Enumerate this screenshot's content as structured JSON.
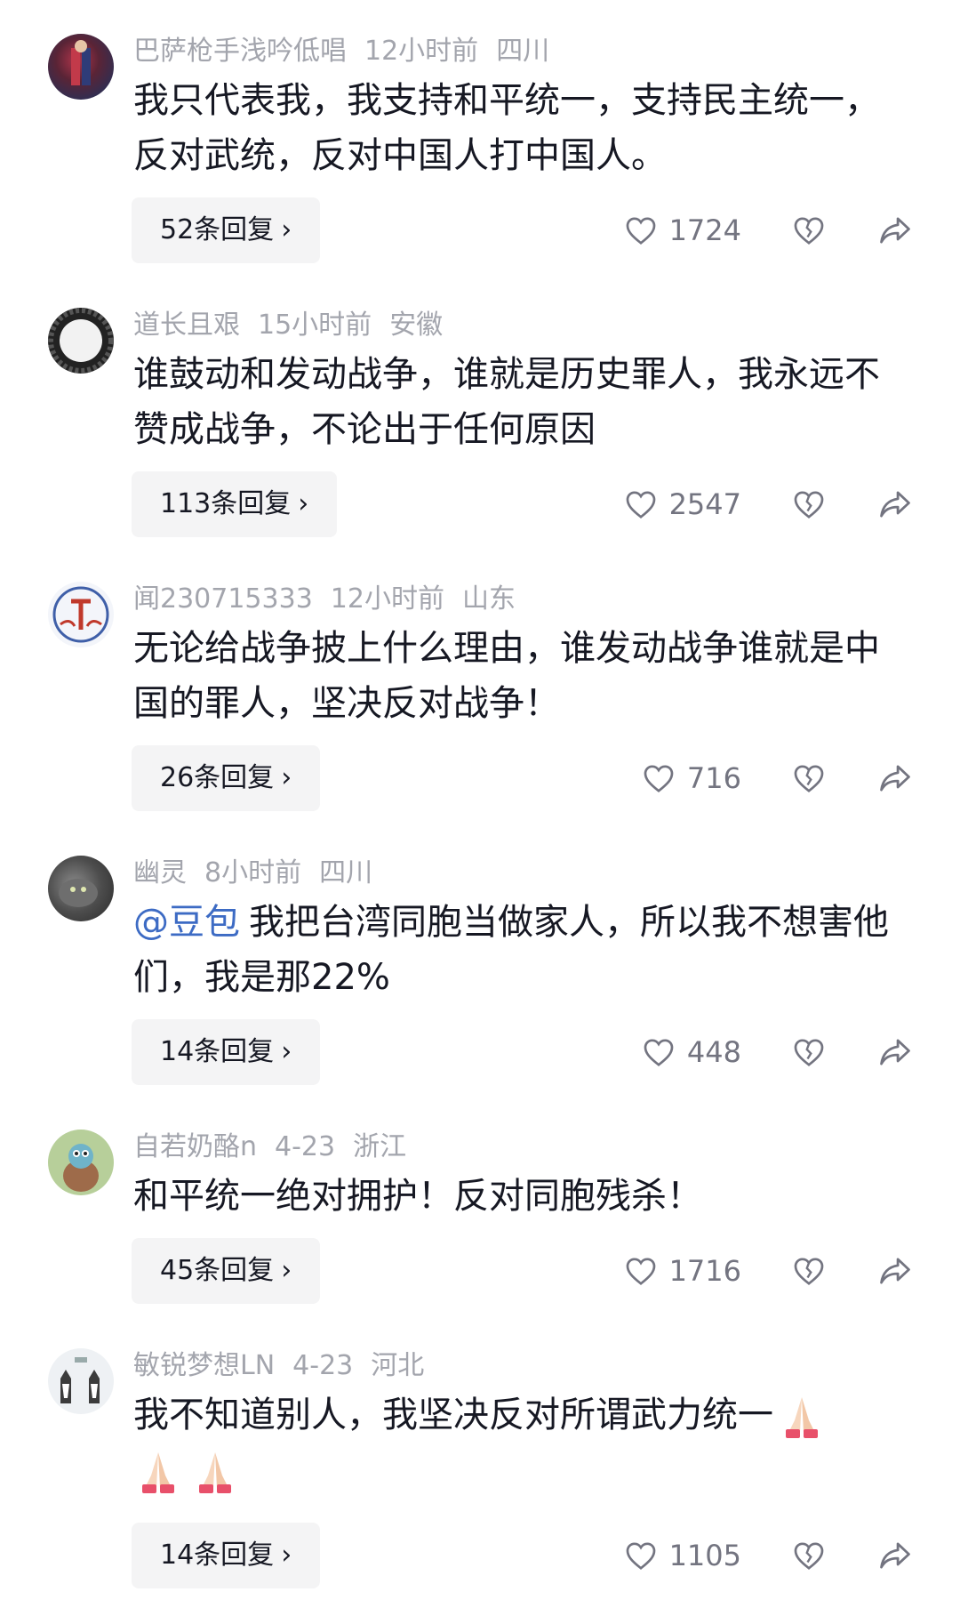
{
  "comments": [
    {
      "username": "巴萨枪手浅吟低唱",
      "time": "12小时前",
      "location": "四川",
      "text": "我只代表我，我支持和平统一，支持民主统一，反对武统，反对中国人打中国人。",
      "replies": "52条回复",
      "likes": "1724"
    },
    {
      "username": "道长且艰",
      "time": "15小时前",
      "location": "安徽",
      "text": "谁鼓动和发动战争，谁就是历史罪人，我永远不赞成战争，不论出于任何原因",
      "replies": "113条回复",
      "likes": "2547"
    },
    {
      "username": "闻230715333",
      "time": "12小时前",
      "location": "山东",
      "text": "无论给战争披上什么理由，谁发动战争谁就是中国的罪人，坚决反对战争！",
      "replies": "26条回复",
      "likes": "716"
    },
    {
      "username": "幽灵",
      "time": "8小时前",
      "location": "四川",
      "mention": "@豆包",
      "text": "我把台湾同胞当做家人，所以我不想害他们，我是那22%",
      "replies": "14条回复",
      "likes": "448"
    },
    {
      "username": "自若奶酪n",
      "time": "4-23",
      "location": "浙江",
      "text": "和平统一绝对拥护！反对同胞残杀！",
      "replies": "45条回复",
      "likes": "1716"
    },
    {
      "username": "敏锐梦想LN",
      "time": "4-23",
      "location": "河北",
      "text": "我不知道别人，我坚决反对所谓武力统一",
      "replies": "14条回复",
      "likes": "1105"
    }
  ],
  "icons": {
    "like": "heart-outline-icon",
    "dislike": "broken-heart-icon",
    "share": "share-arrow-icon",
    "emoji": "folded-hands-emoji"
  },
  "colors": {
    "meta": "#a3a5ad",
    "text": "#161823",
    "mention": "#3d6bc4",
    "reply_bg": "#f4f4f5",
    "icon": "#737480"
  }
}
